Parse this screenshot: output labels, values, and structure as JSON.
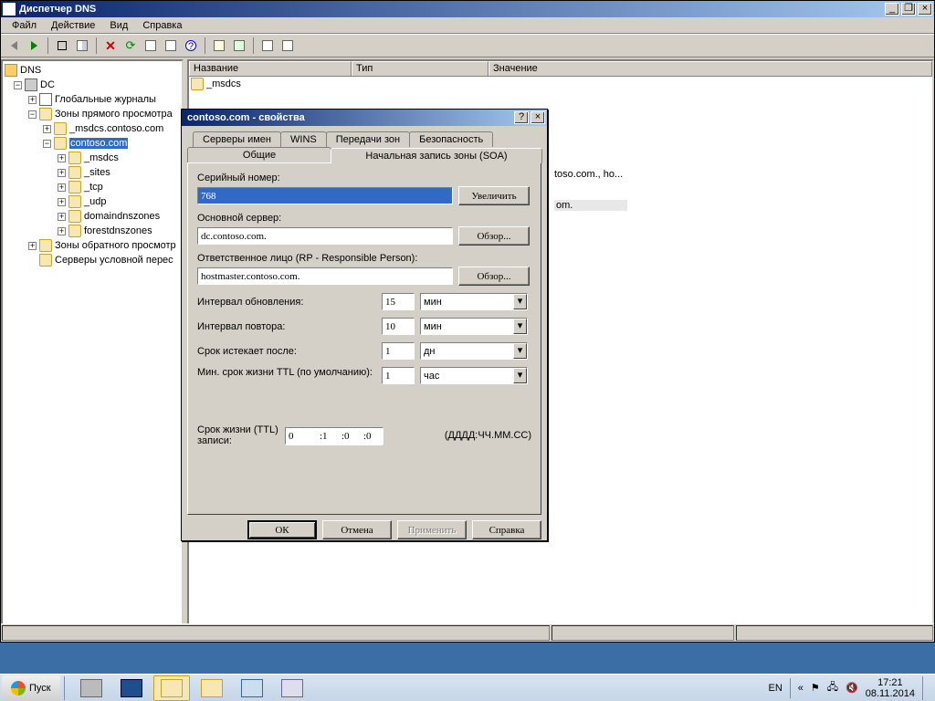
{
  "window": {
    "title": "Диспетчер DNS",
    "menus": [
      "Файл",
      "Действие",
      "Вид",
      "Справка"
    ]
  },
  "tree": {
    "root": "DNS",
    "server": "DC",
    "nodes": {
      "globals": "Глобальные журналы",
      "fwd": "Зоны прямого просмотра",
      "msdcs_contoso": "_msdcs.contoso.com",
      "contoso": "contoso.com",
      "msdcs": "_msdcs",
      "sites": "_sites",
      "tcp": "_tcp",
      "udp": "_udp",
      "domaindns": "domaindnszones",
      "forestdns": "forestdnszones",
      "rev": "Зоны обратного просмотр",
      "cond": "Серверы условной перес"
    }
  },
  "list": {
    "cols": [
      "Название",
      "Тип",
      "Значение"
    ],
    "row0": "_msdcs",
    "ghost1": "toso.com., ho...",
    "ghost2": "om."
  },
  "dialog": {
    "title": "contoso.com - свойства",
    "tabs": {
      "ns": "Серверы имен",
      "wins": "WINS",
      "transfers": "Передачи зон",
      "security": "Безопасность",
      "general": "Общие",
      "soa": "Начальная запись зоны (SOA)"
    },
    "labels": {
      "serial": "Серийный номер:",
      "increment": "Увеличить",
      "primary": "Основной сервер:",
      "browse": "Обзор...",
      "rp": "Ответственное лицо (RP - Responsible Person):",
      "refresh": "Интервал обновления:",
      "retry": "Интервал повтора:",
      "expire": "Срок истекает после:",
      "minttl": "Мин. срок жизни TTL (по умолчанию):",
      "ttl": "Срок жизни (TTL) записи:",
      "ttlfmt": "(ДДДД:ЧЧ.ММ.СС)"
    },
    "values": {
      "serial": "768",
      "primary": "dc.contoso.com.",
      "rp": "hostmaster.contoso.com.",
      "refresh_val": "15",
      "refresh_unit": "мин",
      "retry_val": "10",
      "retry_unit": "мин",
      "expire_val": "1",
      "expire_unit": "дн",
      "minttl_val": "1",
      "minttl_unit": "час",
      "ttl_d": "0",
      "ttl_h": ":1",
      "ttl_m": ":0",
      "ttl_s": ":0"
    },
    "buttons": {
      "ok": "ОК",
      "cancel": "Отмена",
      "apply": "Применить",
      "help": "Справка"
    }
  },
  "taskbar": {
    "start": "Пуск",
    "lang": "EN",
    "time": "17:21",
    "date": "08.11.2014"
  }
}
